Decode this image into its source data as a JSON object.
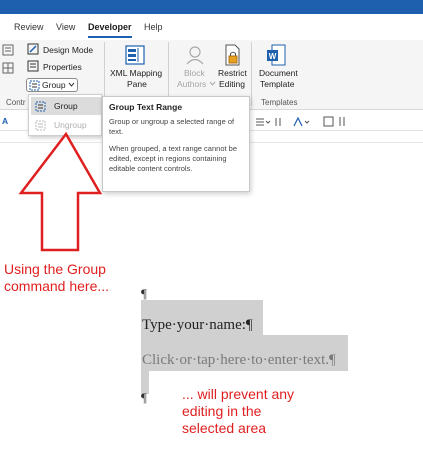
{
  "tabs": [
    "Review",
    "View",
    "Developer",
    "Help"
  ],
  "ribbon": {
    "design_mode": "Design Mode",
    "properties": "Properties",
    "group_button": "Group",
    "group_label_controls": "Contr",
    "xml_mapping_line1": "XML Mapping",
    "xml_mapping_line2": "Pane",
    "block_line1": "Block",
    "block_line2": "Authors",
    "restrict_line1": "Restrict",
    "restrict_line2": "Editing",
    "doc_template_line1": "Document",
    "doc_template_line2": "Template",
    "templates_label": "Templates"
  },
  "dropdown": {
    "group": "Group",
    "ungroup": "Ungroup"
  },
  "tooltip": {
    "title": "Group Text Range",
    "body1": "Group or ungroup a selected range of text.",
    "body2": "When grouped, a text range cannot be edited, except in regions containing editable content controls."
  },
  "document": {
    "pilcrow": "¶",
    "line1": "Type·your·name:¶",
    "line2": "Click·or·tap·here·to·enter·text.¶"
  },
  "annotations": {
    "left_line1": "Using the Group",
    "left_line2": "command here...",
    "right_line1": "... will prevent any",
    "right_line2": "editing in the",
    "right_line3": "selected area"
  },
  "colors": {
    "accent": "#1e5fae",
    "annotation": "#e02020",
    "selection": "#d0d0d0"
  }
}
